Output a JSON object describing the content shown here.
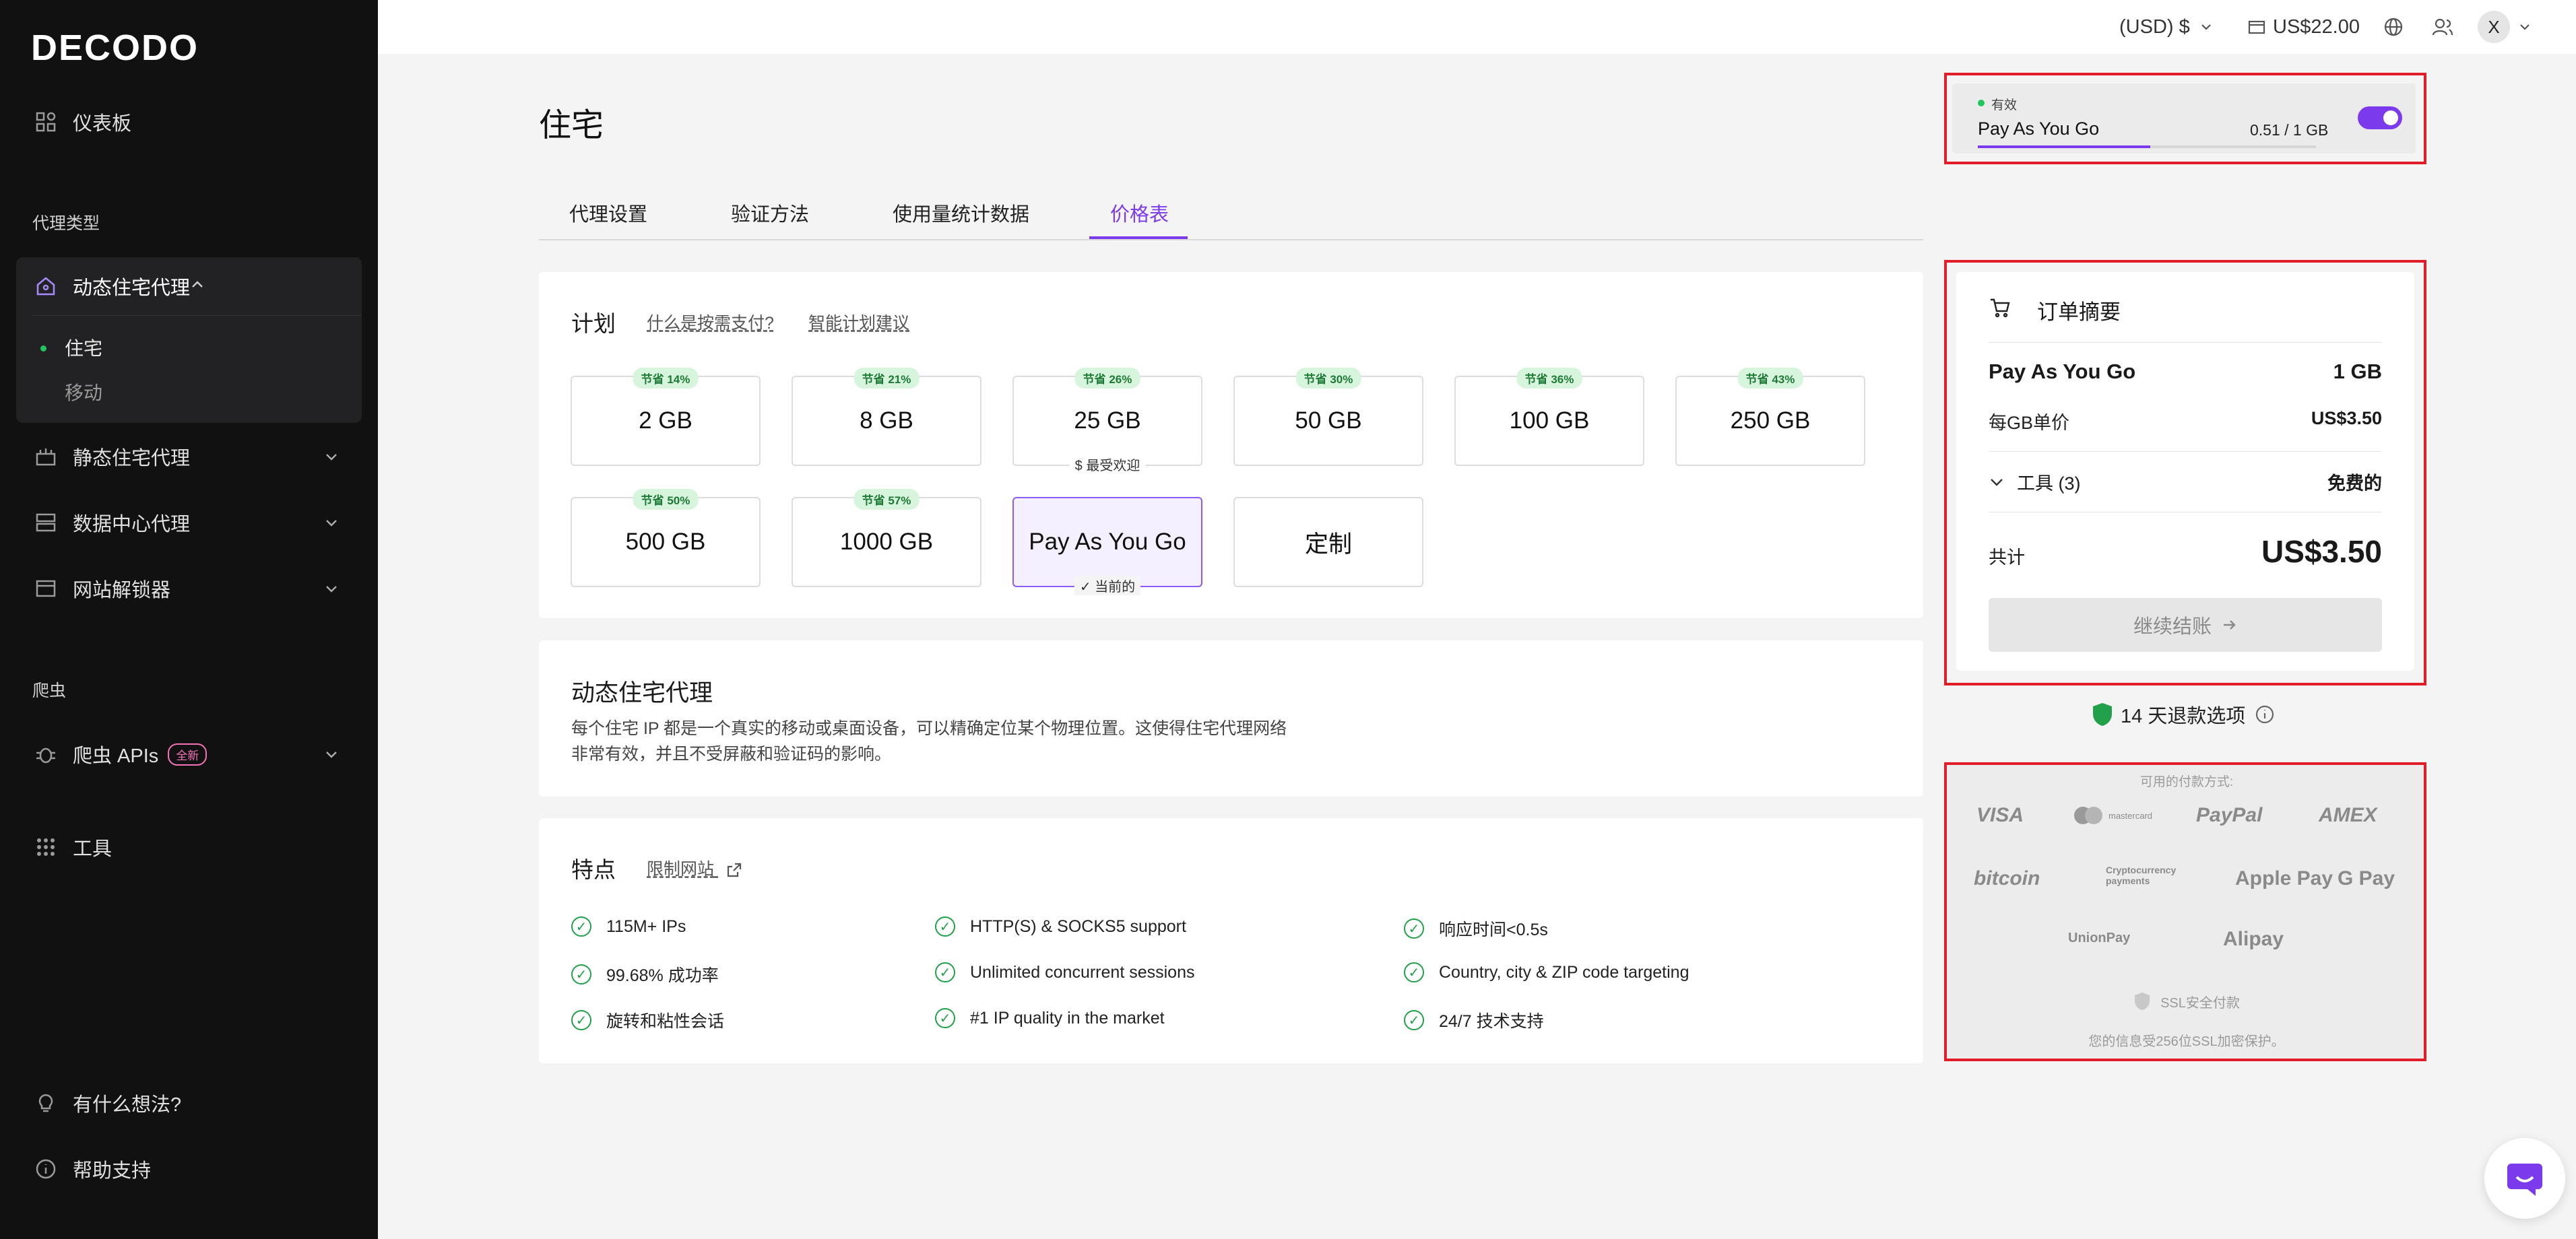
{
  "brand": "DECODO",
  "sidebar": {
    "dashboard": "仪表板",
    "proxy_types_label": "代理类型",
    "residential": {
      "label": "动态住宅代理",
      "sub_items": [
        "住宅",
        "移动"
      ]
    },
    "static_residential": "静态住宅代理",
    "datacenter": "数据中心代理",
    "site_unblocker": "网站解锁器",
    "scraper_label": "爬虫",
    "scraper_apis": "爬虫 APIs",
    "new_badge": "全新",
    "tools": "工具",
    "feedback": "有什么想法?",
    "help": "帮助支持"
  },
  "topbar": {
    "currency": "(USD) $",
    "balance": "US$22.00",
    "avatar_letter": "X"
  },
  "page": {
    "title": "住宅",
    "tabs": [
      "代理设置",
      "验证方法",
      "使用量统计数据",
      "价格表"
    ]
  },
  "plan": {
    "title": "计划",
    "link1": "什么是按需支付?",
    "link2": "智能计划建议",
    "tiles": [
      {
        "label": "2 GB",
        "badge": "节省 14%"
      },
      {
        "label": "8 GB",
        "badge": "节省 21%"
      },
      {
        "label": "25 GB",
        "badge": "节省 26%",
        "sub": "$ 最受欢迎"
      },
      {
        "label": "50 GB",
        "badge": "节省 30%"
      },
      {
        "label": "100 GB",
        "badge": "节省 36%"
      },
      {
        "label": "250 GB",
        "badge": "节省 43%"
      },
      {
        "label": "500 GB",
        "badge": "节省 50%"
      },
      {
        "label": "1000 GB",
        "badge": "节省 57%"
      },
      {
        "label": "Pay As You Go",
        "sub": "✓ 当前的"
      },
      {
        "label": "定制"
      }
    ]
  },
  "description": {
    "title": "动态住宅代理",
    "text_line1": "每个住宅 IP 都是一个真实的移动或桌面设备，可以精确定位某个物理位置。这使得住宅代理网络",
    "text_line2": "非常有效，并且不受屏蔽和验证码的影响。"
  },
  "features": {
    "title": "特点",
    "link": "限制网站",
    "items": [
      "115M+ IPs",
      "HTTP(S) & SOCKS5 support",
      "响应时间<0.5s",
      "99.68% 成功率",
      "Unlimited concurrent sessions",
      "Country, city & ZIP code targeting",
      "旋转和粘性会话",
      "#1 IP quality in the market",
      "24/7 技术支持"
    ]
  },
  "status": {
    "state": "有效",
    "plan": "Pay As You Go",
    "usage": "0.51 / 1 GB",
    "usage_fraction": 0.51
  },
  "order": {
    "title": "订单摘要",
    "plan": "Pay As You Go",
    "plan_amount": "1 GB",
    "unit_label": "每GB单价",
    "unit_price": "US$3.50",
    "tools_label": "工具 (3)",
    "tools_value": "免费的",
    "total_label": "共计",
    "total_value": "US$3.50",
    "checkout": "继续结账"
  },
  "refund": {
    "days": "14",
    "text": "14 天退款选项"
  },
  "payments": {
    "title": "可用的付款方式:",
    "methods": [
      "VISA",
      "mastercard",
      "PayPal",
      "AMEX",
      "bitcoin",
      "Cryptocurrency payments",
      "Apple Pay",
      "G Pay",
      "UnionPay",
      "Alipay"
    ],
    "ssl": "SSL安全付款",
    "note": "您的信息受256位SSL加密保护。"
  },
  "colors": {
    "accent": "#7c3aed",
    "highlight": "#e11d28",
    "success": "#22a04a"
  }
}
